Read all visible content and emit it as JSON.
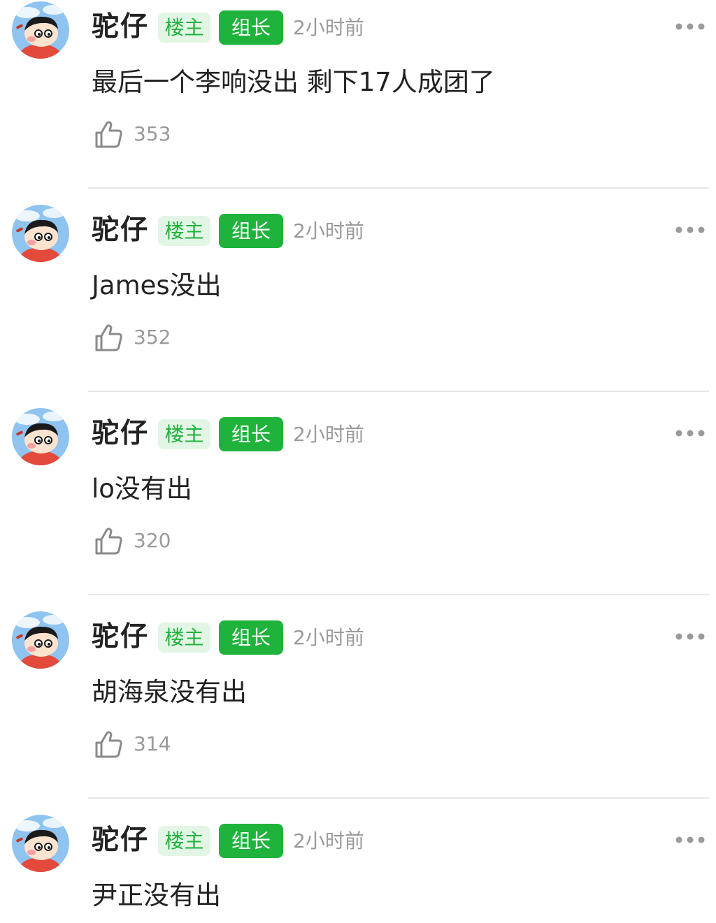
{
  "theme": {
    "accent": "#1fb33c",
    "accent_light": "#e3f6e6",
    "text": "#222222",
    "muted": "#9a9a9a"
  },
  "comments": [
    {
      "user": "驼仔",
      "badge_owner": "楼主",
      "badge_leader": "组长",
      "time": "2小时前",
      "text": "最后一个李响没出 剩下17人成团了",
      "likes": "353",
      "icons": {
        "avatar": "cartoon-avatar-icon",
        "more": "more-dots-icon",
        "like": "thumbs-up-icon"
      }
    },
    {
      "user": "驼仔",
      "badge_owner": "楼主",
      "badge_leader": "组长",
      "time": "2小时前",
      "text": "James没出",
      "likes": "352",
      "icons": {
        "avatar": "cartoon-avatar-icon",
        "more": "more-dots-icon",
        "like": "thumbs-up-icon"
      }
    },
    {
      "user": "驼仔",
      "badge_owner": "楼主",
      "badge_leader": "组长",
      "time": "2小时前",
      "text": "lo没有出",
      "likes": "320",
      "icons": {
        "avatar": "cartoon-avatar-icon",
        "more": "more-dots-icon",
        "like": "thumbs-up-icon"
      }
    },
    {
      "user": "驼仔",
      "badge_owner": "楼主",
      "badge_leader": "组长",
      "time": "2小时前",
      "text": "胡海泉没有出",
      "likes": "314",
      "icons": {
        "avatar": "cartoon-avatar-icon",
        "more": "more-dots-icon",
        "like": "thumbs-up-icon"
      }
    },
    {
      "user": "驼仔",
      "badge_owner": "楼主",
      "badge_leader": "组长",
      "time": "2小时前",
      "text": "尹正没有出",
      "likes": "",
      "icons": {
        "avatar": "cartoon-avatar-icon",
        "more": "more-dots-icon",
        "like": "thumbs-up-icon"
      }
    }
  ]
}
